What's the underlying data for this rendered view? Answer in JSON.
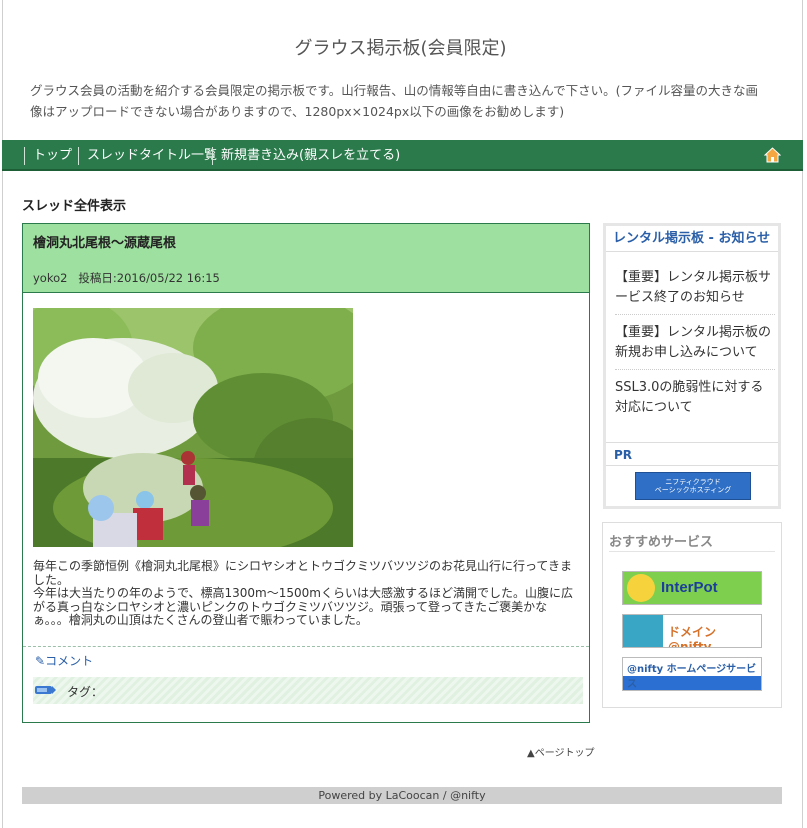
{
  "site": {
    "title": "グラウス掲示板(会員限定)",
    "description": "グラウス会員の活動を紹介する会員限定の掲示板です。山行報告、山の情報等自由に書き込んで下さい。(ファイル容量の大きな画像はアップロードできない場合がありますので、1280px×1024px以下の画像をお勧めします)"
  },
  "nav": {
    "items": [
      "トップ",
      "スレッドタイトル一覧",
      "新規書き込み(親スレを立てる)"
    ],
    "home_icon": "home-icon"
  },
  "section_title": "スレッド全件表示",
  "post": {
    "title": "檜洞丸北尾根～源蔵尾根",
    "author": "yoko2",
    "posted": "投稿日:2016/05/22 16:15",
    "body": [
      "毎年この季節恒例《檜洞丸北尾根》にシロヤシオとトウゴクミツバツツジのお花見山行に行ってきました。",
      "今年は大当たりの年のようで、標高1300m～1500mくらいは大感激するほど満開でした。山腹に広がる真っ白なシロヤシオと濃いピンクのトウゴクミツバツツジ。頑張って登ってきたご褒美かなぁ。。。檜洞丸の山頂はたくさんの登山者で賑わっていました。"
    ],
    "comment_label": "コメント",
    "tag_label": "タグ："
  },
  "page_top": "ページトップ",
  "footer": "Powered by LaCoocan / @nifty",
  "sidebar": {
    "notice_title": "レンタル掲示板 - お知らせ",
    "notices": [
      "【重要】レンタル掲示板サービス終了のお知らせ",
      "【重要】レンタル掲示板の新規お申し込みについて",
      "SSL3.0の脆弱性に対する対応について"
    ],
    "pr_title": "PR",
    "pr_banner": [
      "ニフティクラウド",
      "ベーシックホスティング"
    ],
    "recommend_title": "おすすめサービス",
    "recommend_banners": [
      "InterPot",
      "ドメイン @nifty",
      "@nifty ホームページサービス"
    ]
  },
  "colors": {
    "nav_bg": "#2b7a4c",
    "post_head_bg": "#9ee09f",
    "link": "#2a5fa8"
  }
}
